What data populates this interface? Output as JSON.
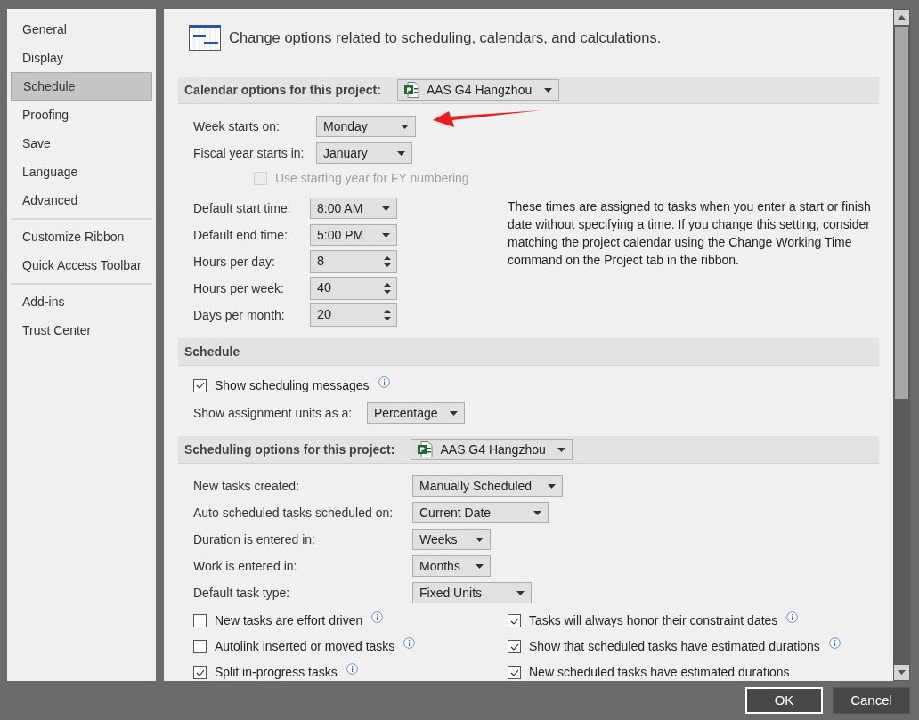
{
  "sidebar": {
    "groups": [
      [
        {
          "label": "General",
          "selected": false
        },
        {
          "label": "Display",
          "selected": false
        },
        {
          "label": "Schedule",
          "selected": true
        },
        {
          "label": "Proofing",
          "selected": false
        },
        {
          "label": "Save",
          "selected": false
        },
        {
          "label": "Language",
          "selected": false
        },
        {
          "label": "Advanced",
          "selected": false
        }
      ],
      [
        {
          "label": "Customize Ribbon",
          "selected": false
        },
        {
          "label": "Quick Access Toolbar",
          "selected": false
        }
      ],
      [
        {
          "label": "Add-ins",
          "selected": false
        },
        {
          "label": "Trust Center",
          "selected": false
        }
      ]
    ]
  },
  "header": "Change options related to scheduling, calendars, and calculations.",
  "calendar": {
    "title": "Calendar options for this project:",
    "project": "AAS G4 Hangzhou",
    "top_fields": [
      {
        "label": "Week starts on:",
        "value": "Monday",
        "kind": "dropdown"
      },
      {
        "label": "Fiscal year starts in:",
        "value": "January",
        "kind": "dropdown"
      }
    ],
    "fy_option": {
      "label": "Use starting year for FY numbering",
      "checked": false,
      "disabled": true
    },
    "time_fields": [
      {
        "label": "Default start time:",
        "value": "8:00 AM",
        "kind": "dropdown"
      },
      {
        "label": "Default end time:",
        "value": "5:00 PM",
        "kind": "dropdown"
      },
      {
        "label": "Hours per day:",
        "value": "8",
        "kind": "spin"
      },
      {
        "label": "Hours per week:",
        "value": "40",
        "kind": "spin"
      },
      {
        "label": "Days per month:",
        "value": "20",
        "kind": "spin"
      }
    ],
    "note": "These times are assigned to tasks when you enter a start or finish date without specifying a time. If you change this setting, consider matching the project calendar using the Change Working Time command on the Project tab in the ribbon."
  },
  "schedule": {
    "title": "Schedule",
    "show_messages": {
      "label": "Show scheduling messages",
      "checked": true,
      "info": true
    },
    "units": {
      "label": "Show assignment units as a:",
      "value": "Percentage"
    }
  },
  "scheduling": {
    "title": "Scheduling options for this project:",
    "project": "AAS G4 Hangzhou",
    "fields": [
      {
        "label": "New tasks created:",
        "value": "Manually Scheduled"
      },
      {
        "label": "Auto scheduled tasks scheduled on:",
        "value": "Current Date"
      },
      {
        "label": "Duration is entered in:",
        "value": "Weeks"
      },
      {
        "label": "Work is entered in:",
        "value": "Months"
      },
      {
        "label": "Default task type:",
        "value": "Fixed Units"
      }
    ],
    "left_options": [
      {
        "label": "New tasks are effort driven",
        "checked": false,
        "info": true
      },
      {
        "label": "Autolink inserted or moved tasks",
        "checked": false,
        "info": true
      },
      {
        "label": "Split in-progress tasks",
        "checked": true,
        "info": true
      }
    ],
    "right_options": [
      {
        "label": "Tasks will always honor their constraint dates",
        "checked": true,
        "info": true
      },
      {
        "label": "Show that scheduled tasks have estimated durations",
        "checked": true,
        "info": true
      },
      {
        "label": "New scheduled tasks have estimated durations",
        "checked": true,
        "info": false
      }
    ]
  },
  "buttons": [
    {
      "label": "OK",
      "kind": "default"
    },
    {
      "label": "Cancel",
      "kind": "normal"
    }
  ]
}
